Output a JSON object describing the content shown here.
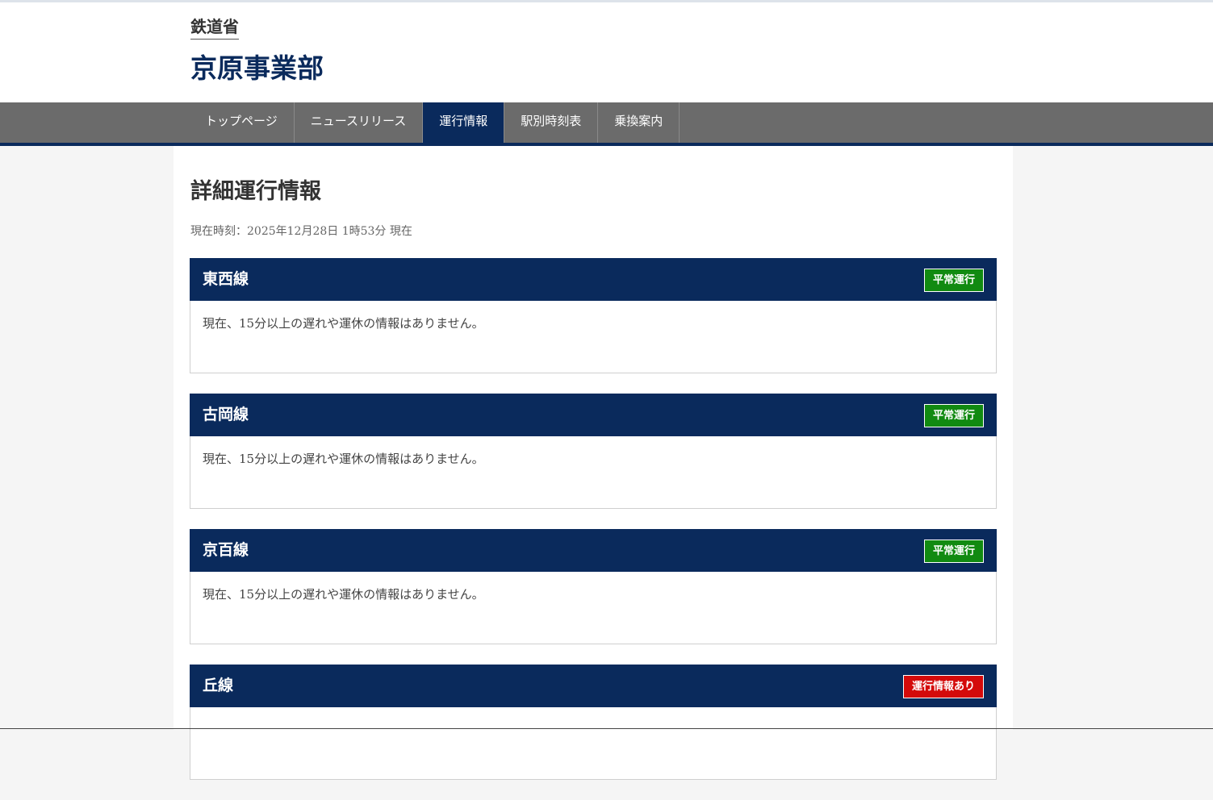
{
  "header": {
    "ministry": "鉄道省",
    "division": "京原事業部"
  },
  "nav": {
    "items": [
      {
        "label": "トップページ"
      },
      {
        "label": "ニュースリリース"
      },
      {
        "label": "運行情報",
        "active": true
      },
      {
        "label": "駅別時刻表"
      },
      {
        "label": "乗換案内"
      }
    ]
  },
  "main": {
    "title": "詳細運行情報",
    "current_time": "現在時刻：2025年12月28日 1時53分 現在",
    "lines": [
      {
        "name": "東西線",
        "status": "平常運行",
        "status_type": "normal",
        "message": "現在、15分以上の遅れや運休の情報はありません。"
      },
      {
        "name": "古岡線",
        "status": "平常運行",
        "status_type": "normal",
        "message": "現在、15分以上の遅れや運休の情報はありません。"
      },
      {
        "name": "京百線",
        "status": "平常運行",
        "status_type": "normal",
        "message": "現在、15分以上の遅れや運休の情報はありません。"
      },
      {
        "name": "丘線",
        "status": "運行情報あり",
        "status_type": "alert",
        "message": ""
      }
    ]
  },
  "colors": {
    "navy": "#0a2a5c",
    "nav_gray": "#6b6b6b",
    "status_normal": "#118a11",
    "status_alert": "#d40a0a"
  }
}
